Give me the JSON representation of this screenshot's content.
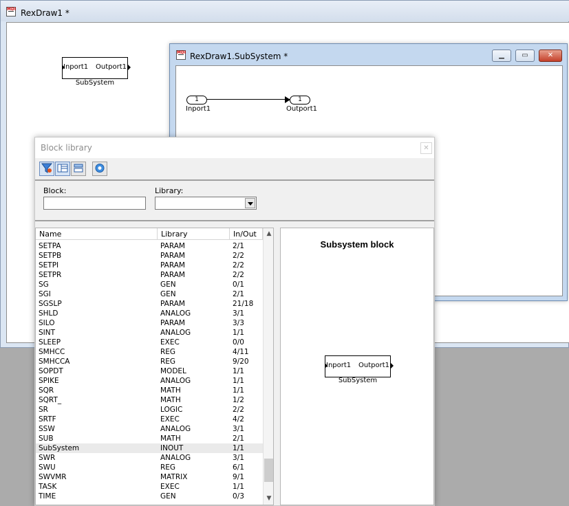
{
  "main_window": {
    "title": "RexDraw1 *",
    "block": {
      "inport": "Inport1",
      "outport": "Outport1",
      "caption": "SubSystem"
    }
  },
  "subsystem_window": {
    "title": "RexDraw1.SubSystem *",
    "inport": {
      "number": "1",
      "label": "Inport1"
    },
    "outport": {
      "number": "1",
      "label": "Outport1"
    }
  },
  "block_library": {
    "title": "Block library",
    "close_glyph": "✕",
    "toolbar_icons": [
      "filter-icon",
      "details-view-icon",
      "list-view-icon",
      "help-icon"
    ],
    "filter": {
      "block_label": "Block:",
      "block_value": "",
      "library_label": "Library:",
      "library_value": ""
    },
    "columns": {
      "name": "Name",
      "library": "Library",
      "inout": "In/Out"
    },
    "rows": [
      {
        "name": "SETPA",
        "library": "PARAM",
        "inout": "2/1"
      },
      {
        "name": "SETPB",
        "library": "PARAM",
        "inout": "2/2"
      },
      {
        "name": "SETPI",
        "library": "PARAM",
        "inout": "2/2"
      },
      {
        "name": "SETPR",
        "library": "PARAM",
        "inout": "2/2"
      },
      {
        "name": "SG",
        "library": "GEN",
        "inout": "0/1"
      },
      {
        "name": "SGI",
        "library": "GEN",
        "inout": "2/1"
      },
      {
        "name": "SGSLP",
        "library": "PARAM",
        "inout": "21/18"
      },
      {
        "name": "SHLD",
        "library": "ANALOG",
        "inout": "3/1"
      },
      {
        "name": "SILO",
        "library": "PARAM",
        "inout": "3/3"
      },
      {
        "name": "SINT",
        "library": "ANALOG",
        "inout": "1/1"
      },
      {
        "name": "SLEEP",
        "library": "EXEC",
        "inout": "0/0"
      },
      {
        "name": "SMHCC",
        "library": "REG",
        "inout": "4/11"
      },
      {
        "name": "SMHCCA",
        "library": "REG",
        "inout": "9/20"
      },
      {
        "name": "SOPDT",
        "library": "MODEL",
        "inout": "1/1"
      },
      {
        "name": "SPIKE",
        "library": "ANALOG",
        "inout": "1/1"
      },
      {
        "name": "SQR",
        "library": "MATH",
        "inout": "1/1"
      },
      {
        "name": "SQRT_",
        "library": "MATH",
        "inout": "1/2"
      },
      {
        "name": "SR",
        "library": "LOGIC",
        "inout": "2/2"
      },
      {
        "name": "SRTF",
        "library": "EXEC",
        "inout": "4/2"
      },
      {
        "name": "SSW",
        "library": "ANALOG",
        "inout": "3/1"
      },
      {
        "name": "SUB",
        "library": "MATH",
        "inout": "2/1"
      },
      {
        "name": "SubSystem",
        "library": "INOUT",
        "inout": "1/1"
      },
      {
        "name": "SWR",
        "library": "ANALOG",
        "inout": "3/1"
      },
      {
        "name": "SWU",
        "library": "REG",
        "inout": "6/1"
      },
      {
        "name": "SWVMR",
        "library": "MATRIX",
        "inout": "9/1"
      },
      {
        "name": "TASK",
        "library": "EXEC",
        "inout": "1/1"
      },
      {
        "name": "TIME",
        "library": "GEN",
        "inout": "0/3"
      }
    ],
    "selected_row": "SubSystem",
    "preview": {
      "title": "Subsystem block",
      "block": {
        "inport": "Inport1",
        "outport": "Outport1",
        "caption": "SubSystem"
      }
    }
  }
}
